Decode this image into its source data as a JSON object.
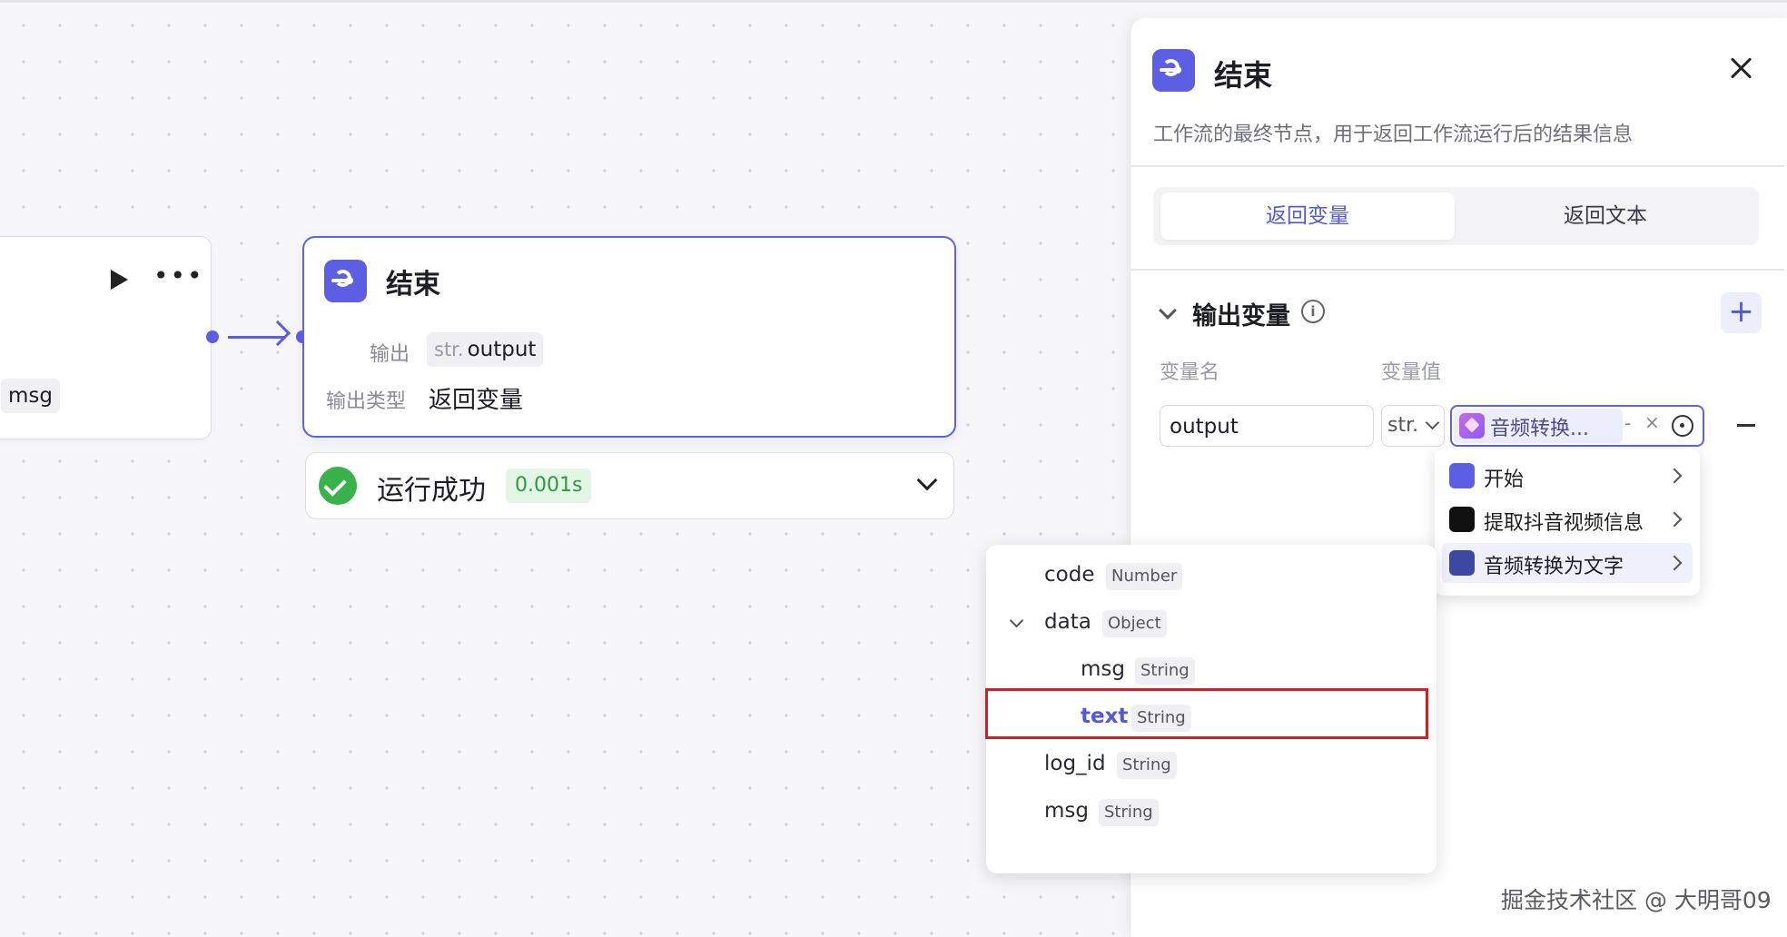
{
  "canvas": {
    "prev_node": {
      "tag": "msg"
    },
    "end_node": {
      "title": "结束",
      "output_label": "输出",
      "output_type": "str.",
      "output_name": "output",
      "output_kind_label": "输出类型",
      "output_kind_value": "返回变量"
    },
    "run_status": {
      "text": "运行成功",
      "time": "0.001s"
    }
  },
  "panel": {
    "title": "结束",
    "description": "工作流的最终节点，用于返回工作流运行后的结果信息",
    "tabs": [
      {
        "label": "返回变量",
        "active": true
      },
      {
        "label": "返回文本",
        "active": false
      }
    ],
    "section_title": "输出变量",
    "columns": {
      "name": "变量名",
      "value": "变量值"
    },
    "row": {
      "name": "output",
      "type": "str.",
      "ref_label": "音频转换...",
      "ref_dash": "-",
      "ref_x": "×"
    }
  },
  "node_picker": {
    "items": [
      {
        "label": "开始",
        "icon": "start-icon",
        "color": "#5c5fe3"
      },
      {
        "label": "提取抖音视频信息",
        "icon": "tiktok-icon",
        "color": "#111111"
      },
      {
        "label": "音频转换为文字",
        "icon": "audio-plugin-icon",
        "color": "#3b4aa0",
        "selected": true
      }
    ]
  },
  "variable_tree": {
    "rows": [
      {
        "name": "code",
        "type": "Number",
        "level": 0
      },
      {
        "name": "data",
        "type": "Object",
        "level": 0,
        "expanded": true
      },
      {
        "name": "msg",
        "type": "String",
        "level": 1
      },
      {
        "name": "text",
        "type": "String",
        "level": 1,
        "highlighted": true
      },
      {
        "name": "log_id",
        "type": "String",
        "level": 0
      },
      {
        "name": "msg",
        "type": "String",
        "level": 0
      }
    ]
  },
  "watermark": "掘金技术社区 @ 大明哥09",
  "colors": {
    "accent": "#5d62e6",
    "success": "#38b24b",
    "highlight_border": "#d21f24"
  }
}
